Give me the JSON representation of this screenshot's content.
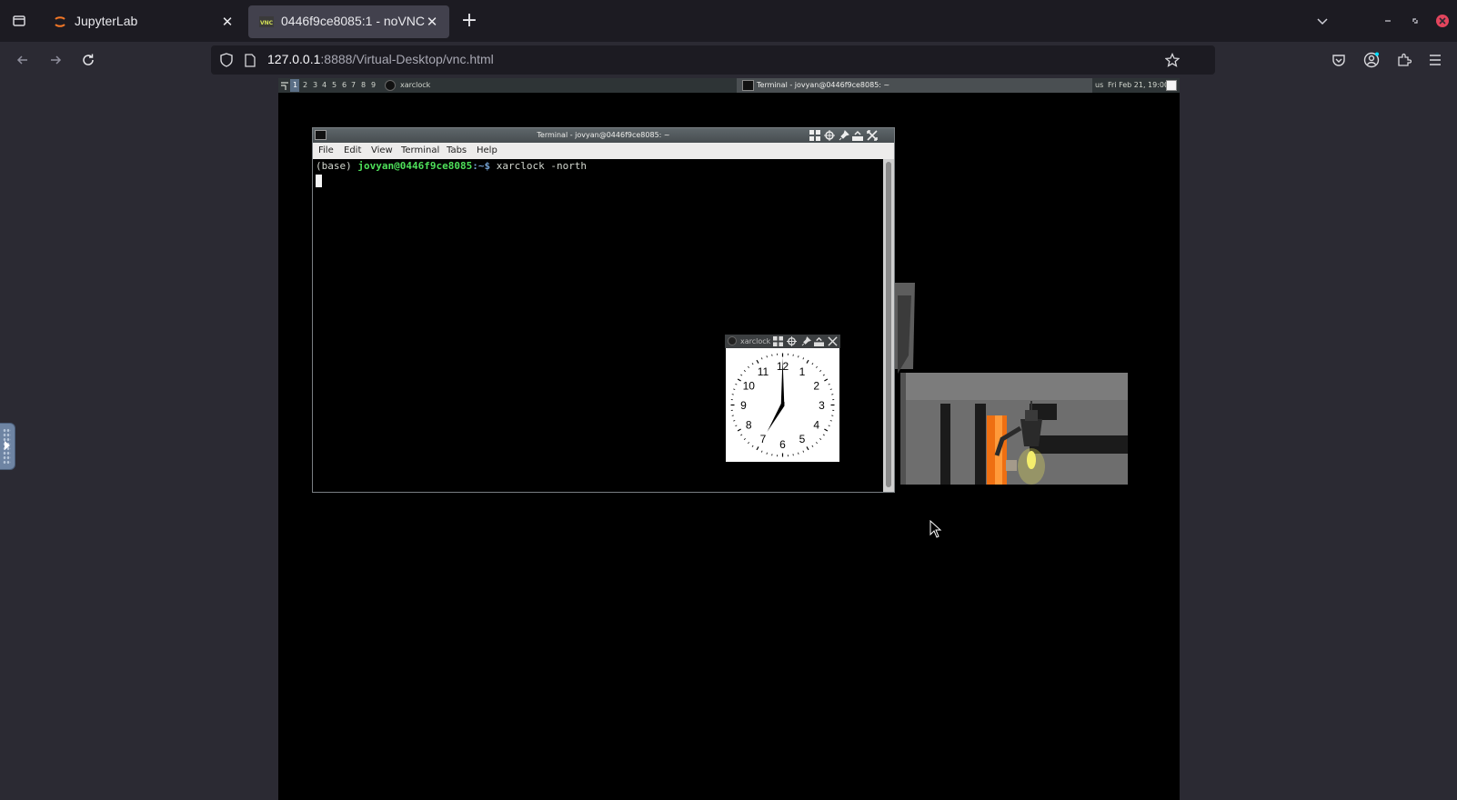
{
  "browser": {
    "tabs": [
      {
        "title": "JupyterLab",
        "active": false
      },
      {
        "title": "0446f9ce8085:1 - noVNC",
        "active": true
      }
    ],
    "url_host": "127.0.0.1",
    "url_rest": ":8888/Virtual-Desktop/vnc.html"
  },
  "desktop": {
    "panel": {
      "workspaces": [
        "1",
        "2",
        "3",
        "4",
        "5",
        "6",
        "7",
        "8",
        "9"
      ],
      "current_workspace": "1",
      "launcher_label": "xarclock",
      "task_label": "Terminal - jovyan@0446f9ce8085: ~",
      "keyboard_layout": "us",
      "clock": "Fri Feb 21, 19:00"
    },
    "terminal": {
      "title": "Terminal - jovyan@0446f9ce8085: ~",
      "menu": [
        "File",
        "Edit",
        "View",
        "Terminal",
        "Tabs",
        "Help"
      ],
      "prompt_env": "(base)",
      "prompt_user": "jovyan@0446f9ce8085",
      "prompt_path": ":~$",
      "command": "xarclock -north"
    },
    "xclock": {
      "title": "xarclock",
      "numbers": [
        "12",
        "1",
        "2",
        "3",
        "4",
        "5",
        "6",
        "7",
        "8",
        "9",
        "10",
        "11"
      ],
      "time": {
        "hour": 7,
        "minute": 0
      }
    }
  },
  "colors": {
    "accent": "#4ee05a",
    "tab_active": "#42414d",
    "chrome_bg": "#1c1b22"
  }
}
